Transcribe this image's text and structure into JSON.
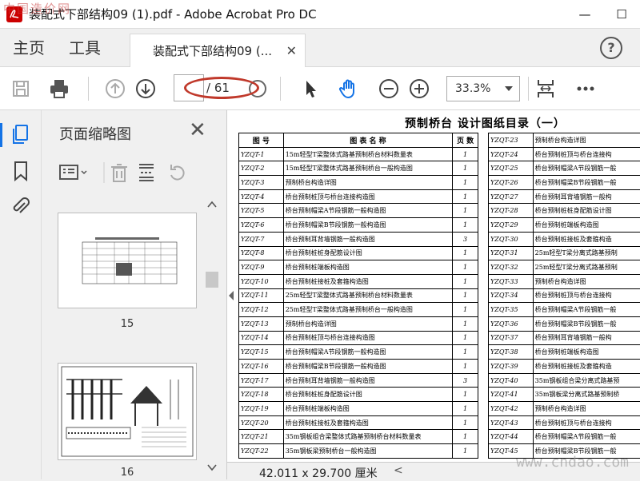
{
  "window": {
    "title": "装配式下部结构09 (1).pdf - Adobe Acrobat Pro DC",
    "watermark_top": "中国造价网",
    "minimize": "—",
    "maximize": "☐"
  },
  "tabs": {
    "home": "主页",
    "tools": "工具",
    "document": "装配式下部结构09 (...",
    "close": "✕"
  },
  "toolbar": {
    "page_current": "",
    "page_total": "/ 61",
    "zoom": "33.3%"
  },
  "panel": {
    "title": "页面缩略图",
    "close": "✕",
    "thumbnails": [
      {
        "label": "15"
      },
      {
        "label": "16"
      }
    ]
  },
  "document": {
    "title": "预制桥台  设计图纸目录（一）",
    "left_headers": [
      "图 号",
      "图 表 名 称",
      "页 数"
    ],
    "left_rows": [
      [
        "YZQT-1",
        "15m轻型T梁整体式路基预制桥台材料数量表",
        "1"
      ],
      [
        "YZQT-2",
        "15m轻型T梁整体式路基预制桥台一般构造图",
        "1"
      ],
      [
        "YZQT-3",
        "预制桥台构造详图",
        "1"
      ],
      [
        "YZQT-4",
        "桥台预制桩顶与桥台连接构造图",
        "1"
      ],
      [
        "YZQT-5",
        "桥台预制帽梁A节段钢筋一般构造图",
        "1"
      ],
      [
        "YZQT-6",
        "桥台预制帽梁B节段钢筋一般构造图",
        "1"
      ],
      [
        "YZQT-7",
        "桥台预制耳背墙钢筋一般构造图",
        "3"
      ],
      [
        "YZQT-8",
        "桥台预制桩桩身配筋设计图",
        "1"
      ],
      [
        "YZQT-9",
        "桥台预制桩端板构造图",
        "1"
      ],
      [
        "YZQT-10",
        "桥台预制桩接桩及套箍构造图",
        "1"
      ],
      [
        "YZQT-11",
        "25m轻型T梁整体式路基预制桥台材料数量表",
        "1"
      ],
      [
        "YZQT-12",
        "25m轻型T梁整体式路基预制桥台一般构造图",
        "1"
      ],
      [
        "YZQT-13",
        "预制桥台构造详图",
        "1"
      ],
      [
        "YZQT-14",
        "桥台预制桩顶与桥台连接构造图",
        "1"
      ],
      [
        "YZQT-15",
        "桥台预制帽梁A节段钢筋一般构造图",
        "1"
      ],
      [
        "YZQT-16",
        "桥台预制帽梁B节段钢筋一般构造图",
        "1"
      ],
      [
        "YZQT-17",
        "桥台预制耳背墙钢筋一般构造图",
        "3"
      ],
      [
        "YZQT-18",
        "桥台预制桩桩身配筋设计图",
        "1"
      ],
      [
        "YZQT-19",
        "桥台预制桩端板构造图",
        "1"
      ],
      [
        "YZQT-20",
        "桥台预制桩接桩及套箍构造图",
        "1"
      ],
      [
        "YZQT-21",
        "35m钢板组合梁整体式路基预制桥台材料数量表",
        "1"
      ],
      [
        "YZQT-22",
        "35m钢板梁预制桥台一般构造图",
        "1"
      ]
    ],
    "right_rows": [
      [
        "YZQT-23",
        "预制桥台构造详图"
      ],
      [
        "YZQT-24",
        "桥台预制桩顶与桥台连接构"
      ],
      [
        "YZQT-25",
        "桥台预制帽梁A节段钢筋一般"
      ],
      [
        "YZQT-26",
        "桥台预制帽梁B节段钢筋一般"
      ],
      [
        "YZQT-27",
        "桥台预制耳背墙钢筋一般构"
      ],
      [
        "YZQT-28",
        "桥台预制桩桩身配筋设计图"
      ],
      [
        "YZQT-29",
        "桥台预制桩端板构造图"
      ],
      [
        "YZQT-30",
        "桥台预制桩接桩及套箍构造"
      ],
      [
        "YZQT-31",
        "25m轻型T梁分离式路基预制"
      ],
      [
        "YZQT-32",
        "25m轻型T梁分离式路基预制"
      ],
      [
        "YZQT-33",
        "预制桥台构造详图"
      ],
      [
        "YZQT-34",
        "桥台预制桩顶与桥台连接构"
      ],
      [
        "YZQT-35",
        "桥台预制帽梁A节段钢筋一般"
      ],
      [
        "YZQT-36",
        "桥台预制帽梁B节段钢筋一般"
      ],
      [
        "YZQT-37",
        "桥台预制耳背墙钢筋一般构"
      ],
      [
        "YZQT-38",
        "桥台预制桩端板构造图"
      ],
      [
        "YZQT-39",
        "桥台预制桩接桩及套箍构造"
      ],
      [
        "YZQT-40",
        "35m钢板组合梁分离式路基预"
      ],
      [
        "YZQT-41",
        "35m钢板梁分离式路基预制桥"
      ],
      [
        "YZQT-42",
        "预制桥台构造详图"
      ],
      [
        "YZQT-43",
        "桥台预制桩顶与桥台连接构"
      ],
      [
        "YZQT-44",
        "桥台预制帽梁A节段钢筋一般"
      ],
      [
        "YZQT-45",
        "桥台预制帽梁B节段钢筋一般"
      ]
    ]
  },
  "status": {
    "dimensions": "42.011 x 29.700 厘米",
    "scroll_left": "<"
  },
  "watermark_bottom": "www.cndao.com",
  "colors": {
    "accent": "#1473e6",
    "annotation": "#c0392b",
    "app_icon": "#cc0000"
  }
}
